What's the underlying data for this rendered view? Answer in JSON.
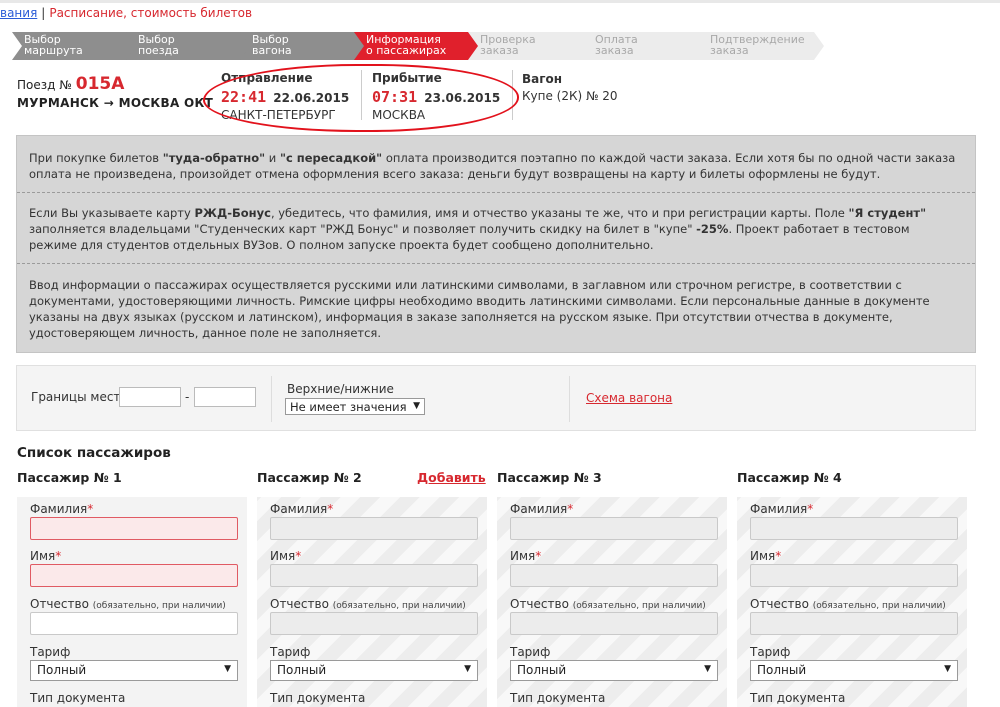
{
  "top_links": {
    "link1": "вания",
    "link2": "Расписание, стоимость билетов"
  },
  "steps": [
    {
      "line1": "Выбор",
      "line2": "маршрута"
    },
    {
      "line1": "Выбор",
      "line2": "поезда"
    },
    {
      "line1": "Выбор",
      "line2": "вагона"
    },
    {
      "line1": "Информация",
      "line2": "о пассажирах"
    },
    {
      "line1": "Проверка",
      "line2": "заказа"
    },
    {
      "line1": "Оплата",
      "line2": "заказа"
    },
    {
      "line1": "Подтверждение",
      "line2": "заказа"
    }
  ],
  "train": {
    "label": "Поезд №",
    "number": "015А",
    "route": "МУРМАНСК → МОСКВА ОКТ"
  },
  "departure": {
    "label": "Отправление",
    "time": "22:41",
    "date": "22.06.2015",
    "city": "САНКТ-ПЕТЕРБУРГ"
  },
  "arrival": {
    "label": "Прибытие",
    "time": "07:31",
    "date": "23.06.2015",
    "city": "МОСКВА"
  },
  "wagon": {
    "label": "Вагон",
    "value": "Купе (2К) № 20"
  },
  "info": {
    "p1_a": "При покупке билетов ",
    "p1_b": "\"туда-обратно\"",
    "p1_c": " и ",
    "p1_d": "\"с пересадкой\"",
    "p1_e": " оплата производится поэтапно по каждой части заказа. Если хотя бы по одной части заказа оплата не произведена, произойдет отмена оформления всего заказа: деньги будут возвращены на карту и билеты оформлены не будут.",
    "p2_a": "Если Вы указываете карту ",
    "p2_b": "РЖД-Бонус",
    "p2_c": ", убедитесь, что фамилия, имя и отчество указаны те же, что и при регистрации карты. Поле ",
    "p2_d": "\"Я студент\"",
    "p2_e": " заполняется владельцами \"Студенческих карт \"РЖД Бонус\" и позволяет получить скидку на билет в \"купе\" ",
    "p2_f": "-25%",
    "p2_g": ". Проект работает в тестовом режиме для студентов отдельных ВУЗов. О полном запуске проекта будет сообщено дополнительно.",
    "p3": "Ввод информации о пассажирах осуществляется русскими или латинскими символами, в заглавном или строчном регистре, в соответствии с документами, удостоверяющими личность. Римские цифры необходимо вводить латинскими символами. Если персональные данные в документе указаны на двух языках (русском и латинском), информация в заказе заполняется на русском языке. При отсутствии отчества в документе, удостоверяющем личность, данное поле не заполняется."
  },
  "filters": {
    "seats_label": "Границы мест",
    "dash": "-",
    "berth_label": "Верхние/нижние",
    "berth_value": "Не имеет значения",
    "scheme_link": "Схема вагона"
  },
  "passengers": {
    "title": "Список пассажиров",
    "add_label": "Добавить",
    "headers": [
      "Пассажир № 1",
      "Пассажир № 2",
      "Пассажир № 3",
      "Пассажир № 4"
    ],
    "surname": "Фамилия",
    "name": "Имя",
    "patronymic": "Отчество",
    "patronymic_note": "(обязательно, при наличии)",
    "tariff": "Тариф",
    "tariff_value": "Полный",
    "doc_type": "Тип документа",
    "star": "*"
  }
}
